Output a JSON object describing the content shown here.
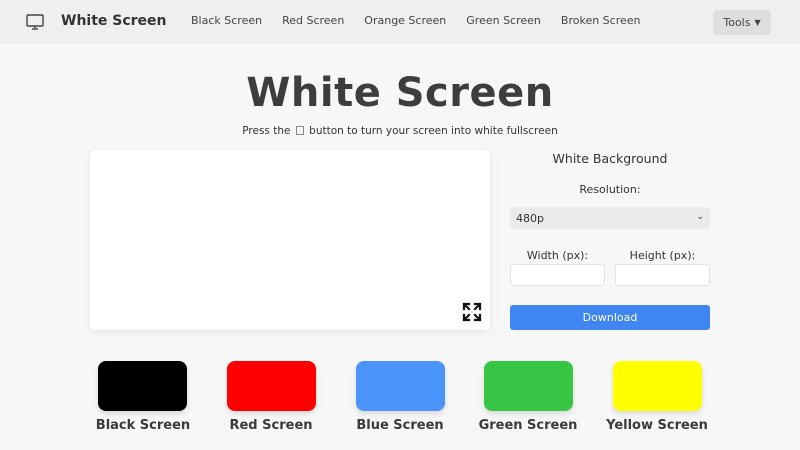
{
  "nav": {
    "brand": "White Screen",
    "links": [
      "Black Screen",
      "Red Screen",
      "Orange Screen",
      "Green Screen",
      "Broken Screen"
    ],
    "tools_label": "Tools"
  },
  "hero": {
    "title": "White Screen",
    "subtitle_before": "Press the",
    "subtitle_after": "button to turn your screen into white fullscreen"
  },
  "panel": {
    "title": "White Background",
    "resolution_label": "Resolution:",
    "resolution_value": "480p",
    "width_label": "Width (px):",
    "height_label": "Height (px):",
    "width_value": "",
    "height_value": "",
    "download_label": "Download"
  },
  "swatches": [
    {
      "label": "Black Screen",
      "color": "#000000"
    },
    {
      "label": "Red Screen",
      "color": "#ff0000"
    },
    {
      "label": "Blue Screen",
      "color": "#4a94fb"
    },
    {
      "label": "Green Screen",
      "color": "#37c544"
    },
    {
      "label": "Yellow Screen",
      "color": "#ffff00"
    }
  ],
  "colors": {
    "accent": "#3f86f2",
    "preview": "#ffffff"
  }
}
